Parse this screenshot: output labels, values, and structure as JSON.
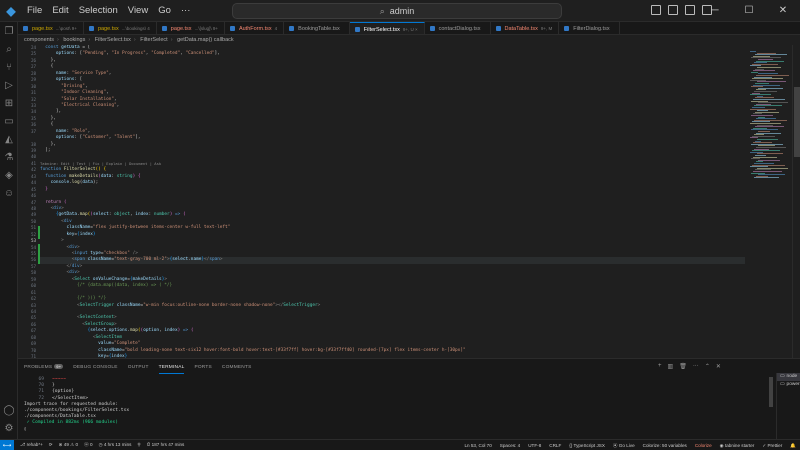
{
  "titlebar": {
    "menu": [
      "File",
      "Edit",
      "Selection",
      "View",
      "Go",
      "···"
    ],
    "search_text": "admin"
  },
  "tabs": [
    {
      "name": "page.tsx",
      "hint": "...\\post\\ 9+",
      "kind": "warn",
      "color": "#3178c6"
    },
    {
      "name": "page.tsx",
      "hint": "...\\bookings\\ 4",
      "kind": "warn",
      "color": "#3178c6"
    },
    {
      "name": "page.tsx",
      "hint": "...\\[slug]\\ 9+",
      "kind": "err",
      "color": "#3178c6"
    },
    {
      "name": "AuthForm.tsx",
      "hint": "4",
      "kind": "err",
      "color": "#3178c6"
    },
    {
      "name": "BookingTable.tsx",
      "hint": "",
      "kind": "",
      "color": "#3178c6"
    },
    {
      "name": "FilterSelect.tsx",
      "hint": "9+, U ×",
      "kind": "active",
      "color": "#3178c6"
    },
    {
      "name": "contactDialog.tsx",
      "hint": "",
      "kind": "",
      "color": "#3178c6"
    },
    {
      "name": "DataTable.tsx",
      "hint": "9+, M",
      "kind": "err",
      "color": "#3178c6"
    },
    {
      "name": "FilterDialog.tsx",
      "hint": "",
      "kind": "",
      "color": "#3178c6"
    }
  ],
  "breadcrumb": [
    "components",
    "bookings",
    "FilterSelect.tsx",
    "FilterSelect",
    "getData.map() callback"
  ],
  "editor": {
    "line_numbers": [
      "24",
      "25",
      "26",
      "27",
      "28",
      "29",
      "30",
      "31",
      "32",
      "33",
      "34",
      "35",
      "36",
      "37",
      "",
      "38",
      "39",
      "40",
      "41",
      "42",
      "43",
      "44",
      "45",
      "46",
      "47",
      "48",
      "49",
      "50",
      "51",
      "52",
      "53",
      "54",
      "55",
      "56",
      "57",
      "58",
      "59",
      "60",
      "61",
      "62",
      "63",
      "64",
      "65",
      "66",
      "67",
      "68",
      "69",
      "70",
      "71",
      "72",
      "73"
    ],
    "current_line": "53",
    "codelens": "Tabnine: Edit | Test | Fix | Explain | Document | Ask"
  },
  "panel": {
    "tabs": [
      {
        "label": "PROBLEMS",
        "badge": "9+"
      },
      {
        "label": "DEBUG CONSOLE",
        "badge": ""
      },
      {
        "label": "OUTPUT",
        "badge": ""
      },
      {
        "label": "TERMINAL",
        "badge": ""
      },
      {
        "label": "PORTS",
        "badge": ""
      },
      {
        "label": "COMMENTS",
        "badge": ""
      }
    ],
    "active_tab": "TERMINAL",
    "terminal_lines": [
      {
        "num": "69",
        "text": "~~~~~"
      },
      {
        "num": "70",
        "text": "}"
      },
      {
        "num": "71",
        "text": "{option}"
      },
      {
        "num": "72",
        "text": "</SelectItem>"
      },
      {
        "num": "",
        "text": ""
      },
      {
        "num": "",
        "text": "Import trace for requested module:"
      },
      {
        "num": "",
        "text": "./components/bookings/FilterSelect.tsx"
      },
      {
        "num": "",
        "text": "./components/DataTable.tsx"
      },
      {
        "num": "",
        "text": " ✓ Compiled in 882ms (966 modules)"
      },
      {
        "num": "",
        "text": "▯"
      }
    ],
    "terminals": [
      "node",
      "powershell"
    ]
  },
  "statusbar": {
    "left": [
      "⎇ rehab*+",
      "⟳",
      "⊗ 49 ⚠ 0",
      "ⓦ 0",
      "◷ 4 hrs 13 mins",
      "⚲",
      "⏱ 187 hrs 47 mins"
    ],
    "right": [
      "Ln 53, Col 70",
      "Spaces: 4",
      "UTF-8",
      "CRLF",
      "{} TypeScript JSX",
      "⦿ Go Live",
      "Colorize: 50 variables",
      "Colorize",
      "◉ tabnine starter",
      "✓ Prettier",
      "🔔"
    ]
  }
}
